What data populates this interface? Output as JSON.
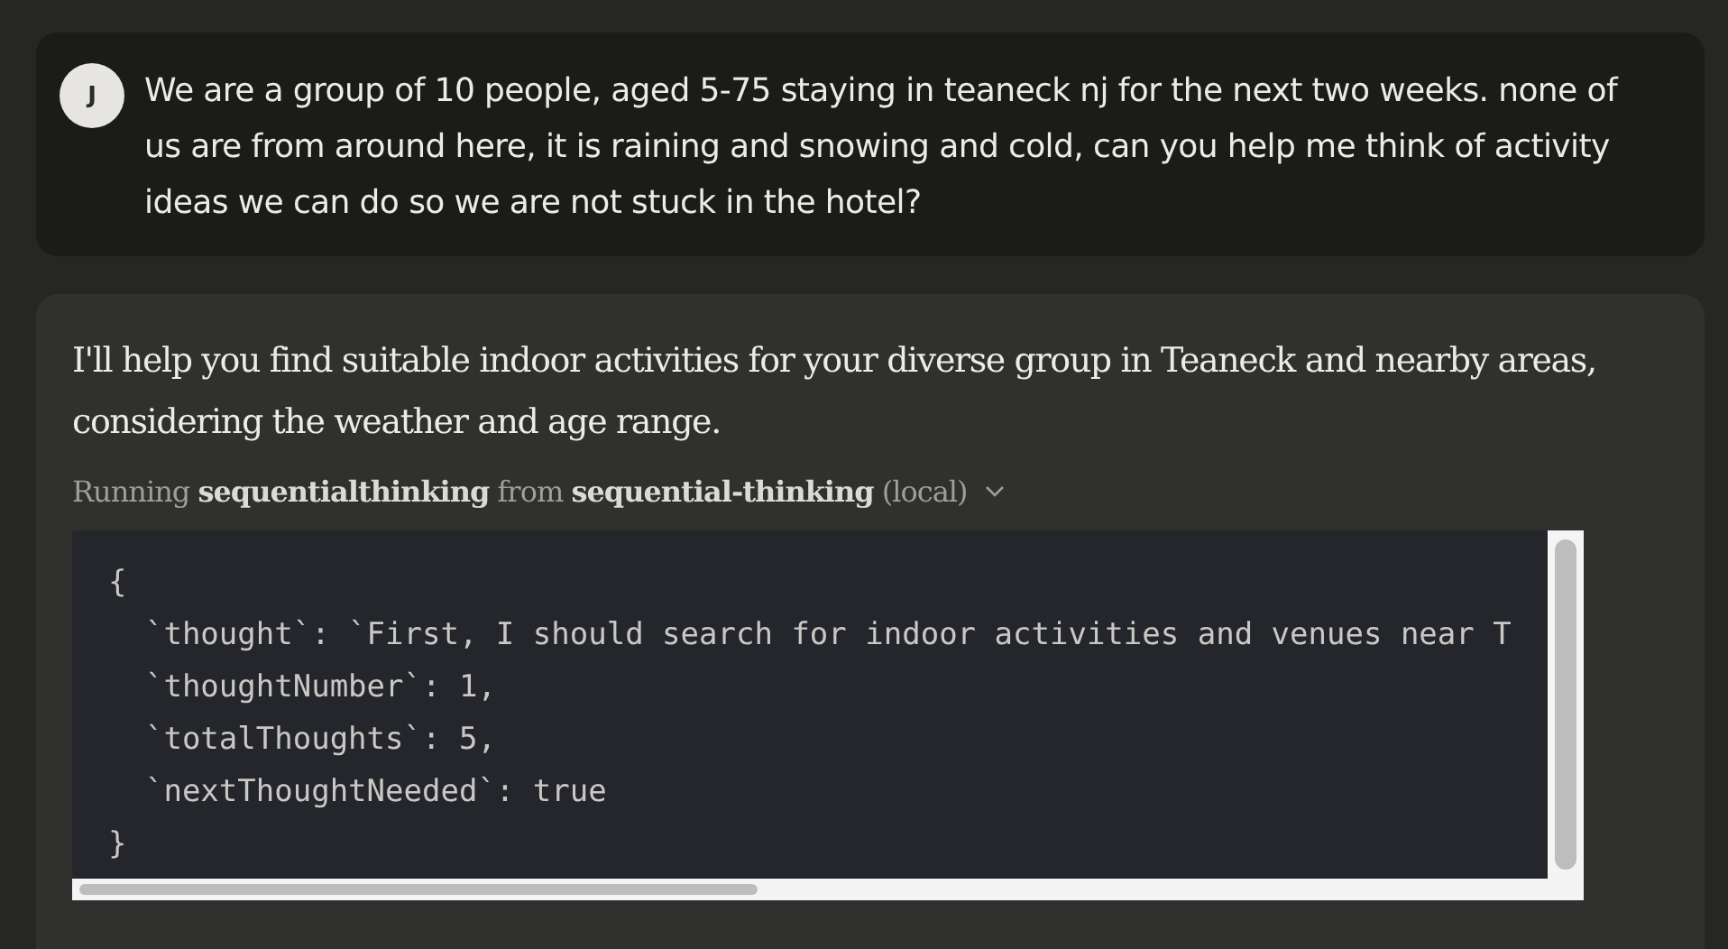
{
  "user_message": {
    "avatar": "J",
    "text": "We are a group of 10 people, aged 5-75 staying in teaneck nj for the next two weeks. none of us are from around here, it is raining and snowing and cold, can you help me think of activity ideas we can do so we are not stuck in the hotel?"
  },
  "assistant_message": {
    "text": "I'll help you find suitable indoor activities for your diverse group in Teaneck and nearby areas, considering the weather and age range.",
    "tool_call": {
      "label": "Running **sequentialthinking** from **sequential-thinking** (local)",
      "expanded": true,
      "code_lines": [
        "{",
        "  `thought`: `First, I should search for indoor activities and venues near T",
        "  `thoughtNumber`: 1,",
        "  `totalThoughts`: 5,",
        "  `nextThoughtNeeded`: true",
        "}"
      ]
    }
  }
}
